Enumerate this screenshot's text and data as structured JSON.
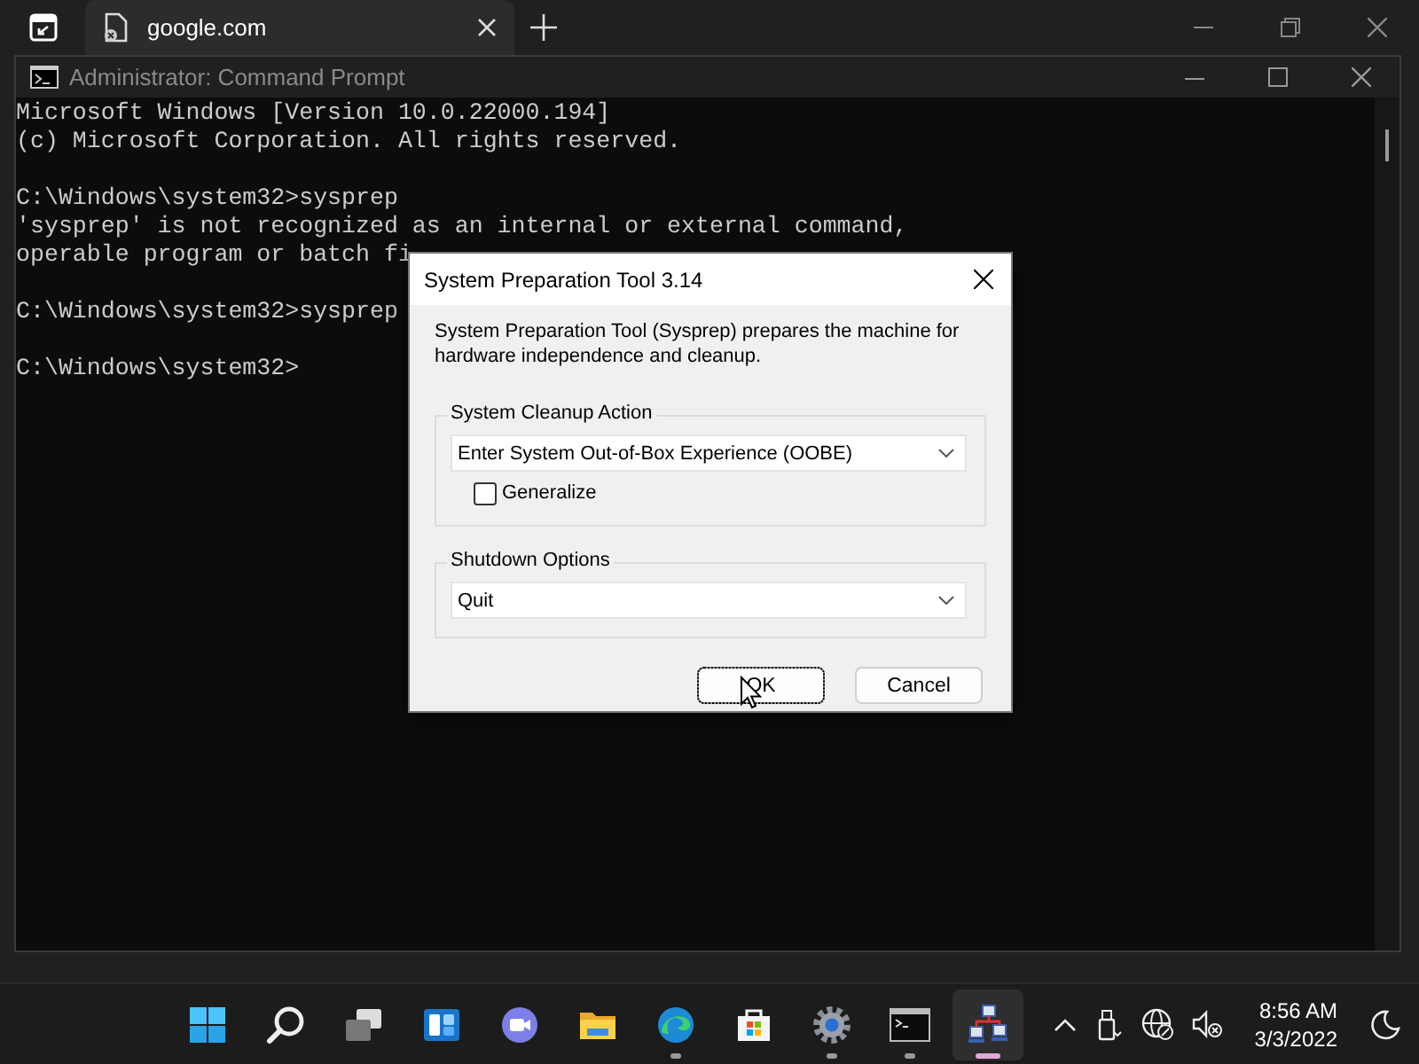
{
  "browser": {
    "tabs": [
      {
        "label": "google.com",
        "selected": true
      }
    ]
  },
  "window": {
    "title": "Administrator: Command Prompt"
  },
  "console": {
    "blocks": [
      [
        "Microsoft Windows [Version 10.0.22000.194]",
        "(c) Microsoft Corporation. All rights reserved."
      ],
      [
        "C:\\Windows\\system32>sysprep",
        "'sysprep' is not recognized as an internal or external command,",
        "operable program or batch fi"
      ],
      [
        "C:\\Windows\\system32>sysprep"
      ],
      [
        "C:\\Windows\\system32>"
      ]
    ]
  },
  "dialog": {
    "title": "System Preparation Tool 3.14",
    "description": "System Preparation Tool (Sysprep) prepares the machine for hardware independence and cleanup.",
    "groups": [
      {
        "label": "System Cleanup Action",
        "dropdown": "Enter System Out-of-Box Experience (OOBE)",
        "checkbox": {
          "label": "Generalize",
          "checked": false
        }
      },
      {
        "label": "Shutdown Options",
        "dropdown": "Quit"
      }
    ],
    "buttons": [
      {
        "label": "OK",
        "focused": true
      },
      {
        "label": "Cancel",
        "focused": false
      }
    ]
  },
  "taskbar": {
    "apps": [
      {
        "kind": "start",
        "running": false,
        "active": false
      },
      {
        "kind": "search",
        "running": false,
        "active": false
      },
      {
        "kind": "taskview",
        "running": false,
        "active": false
      },
      {
        "kind": "widgets",
        "running": false,
        "active": false
      },
      {
        "kind": "chat",
        "running": false,
        "active": false
      },
      {
        "kind": "explorer",
        "running": false,
        "active": false
      },
      {
        "kind": "edge",
        "running": true,
        "active": false
      },
      {
        "kind": "store",
        "running": false,
        "active": false
      },
      {
        "kind": "settings",
        "running": true,
        "active": false
      },
      {
        "kind": "terminal",
        "running": true,
        "active": false
      },
      {
        "kind": "network",
        "running": true,
        "active": true
      }
    ],
    "clock": {
      "time": "8:56 AM",
      "date": "3/3/2022"
    }
  }
}
